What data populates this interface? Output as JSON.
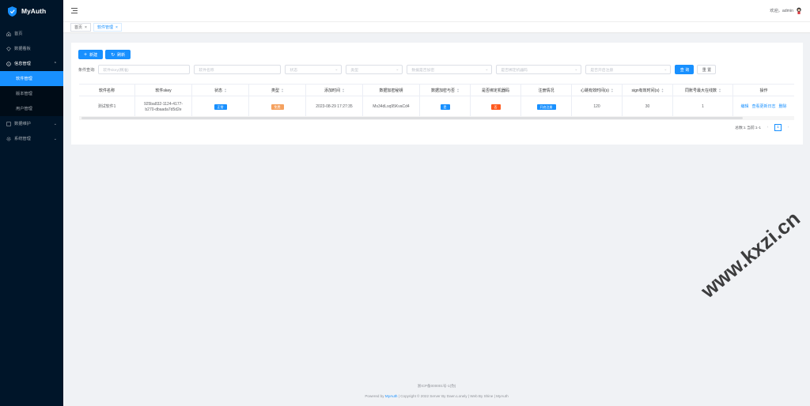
{
  "app": {
    "title": "MyAuth"
  },
  "sidebar": {
    "items": [
      {
        "label": "首页",
        "icon": "home-icon"
      },
      {
        "label": "数据看板",
        "icon": "dashboard-icon"
      },
      {
        "label": "信息管理",
        "icon": "info-icon",
        "expanded": true,
        "children": [
          {
            "label": "软件管理",
            "active": true
          },
          {
            "label": "版本管理"
          },
          {
            "label": "用户管理"
          }
        ]
      },
      {
        "label": "数据维护",
        "icon": "data-icon"
      },
      {
        "label": "系统管理",
        "icon": "gear-icon"
      }
    ]
  },
  "header": {
    "welcome": "欢迎，admin"
  },
  "tags": [
    {
      "label": "首页",
      "close": "×"
    },
    {
      "label": "软件管理",
      "close": "×"
    }
  ],
  "toolbar": {
    "add_label": "新建",
    "refresh_label": "刷新"
  },
  "filter": {
    "label": "条件查询:",
    "fields": [
      {
        "placeholder": "软件skey(精准)"
      },
      {
        "placeholder": "软件名称"
      },
      {
        "placeholder": "状态"
      },
      {
        "placeholder": "类型"
      },
      {
        "placeholder": "数据是否加密"
      },
      {
        "placeholder": "是否绑定机器码"
      },
      {
        "placeholder": "是否开启注册"
      }
    ],
    "search_label": "查 询",
    "reset_label": "重 置"
  },
  "table": {
    "columns": [
      "软件名称",
      "软件skey",
      "状态",
      "类型",
      "添加时间",
      "数据加密秘钥",
      "数据加密与否",
      "是否绑定机器码",
      "注册情况",
      "心跳有效时间(s)",
      "sign有效时间(s)",
      "同账号最大在线数",
      "操作"
    ],
    "rows": [
      {
        "name": "测试软件1",
        "skey": "925ba832-1124-4177-b270-dbaada7d5d2e",
        "status": "正常",
        "type": "免费",
        "time": "2023-08-29 17:27:35",
        "key": "Ms34dLsq95KvaCd4",
        "encrypt": "是",
        "bind": "否",
        "register": "开启注册",
        "heartbeat": "120",
        "sign": "30",
        "online": "1",
        "ops": [
          "编辑",
          "查看更新日志",
          "删除"
        ]
      }
    ]
  },
  "pager": {
    "summary": "总数:1 当前:1-1",
    "prev": "‹",
    "current": "1",
    "next": "›"
  },
  "footer": {
    "icp": "浙ICP备000001号-1(伪)",
    "powered": "Powered by ",
    "brand": "MyAuth",
    "rest": " | Copyright © 2022 Server By Daen.Lonely | Web By Shine | MyAuth"
  },
  "watermark": "www.kxzi.cn",
  "colors": {
    "primary": "#1890ff",
    "sidebar": "#001529",
    "free": "#f5a15f",
    "no": "#ff5a1f"
  }
}
